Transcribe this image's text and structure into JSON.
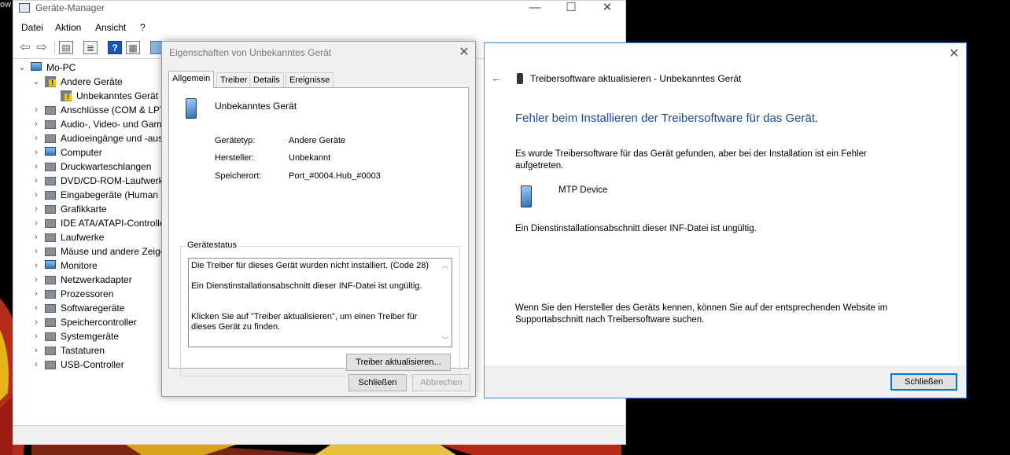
{
  "desktop": {
    "corner_text": "ow"
  },
  "device_manager": {
    "title": "Geräte-Manager",
    "window_controls": [
      "—",
      "☐",
      "✕"
    ],
    "menu": [
      "Datei",
      "Aktion",
      "Ansicht",
      "?"
    ],
    "tree": [
      {
        "label": "Mo-PC",
        "level": 0,
        "expander": "down",
        "icon": "computer-icon"
      },
      {
        "label": "Andere Geräte",
        "level": 1,
        "expander": "down",
        "icon": "warning-device-icon"
      },
      {
        "label": "Unbekanntes Gerät",
        "level": 2,
        "expander": "",
        "icon": "unknown-device-warning-icon"
      },
      {
        "label": "Anschlüsse (COM & LPT)",
        "level": 1,
        "expander": "right",
        "icon": "port-icon"
      },
      {
        "label": "Audio-, Video- und Gamecontroller",
        "level": 1,
        "expander": "right",
        "icon": "speaker-icon"
      },
      {
        "label": "Audioeingänge und -ausgänge",
        "level": 1,
        "expander": "right",
        "icon": "speaker-icon"
      },
      {
        "label": "Computer",
        "level": 1,
        "expander": "right",
        "icon": "monitor-icon"
      },
      {
        "label": "Druckwarteschlangen",
        "level": 1,
        "expander": "right",
        "icon": "printer-icon"
      },
      {
        "label": "DVD/CD-ROM-Laufwerke",
        "level": 1,
        "expander": "right",
        "icon": "disc-icon"
      },
      {
        "label": "Eingabegeräte (Human Interface Devices)",
        "level": 1,
        "expander": "right",
        "icon": "hid-icon"
      },
      {
        "label": "Grafikkarte",
        "level": 1,
        "expander": "right",
        "icon": "display-adapter-icon"
      },
      {
        "label": "IDE ATA/ATAPI-Controller",
        "level": 1,
        "expander": "right",
        "icon": "controller-icon"
      },
      {
        "label": "Laufwerke",
        "level": 1,
        "expander": "right",
        "icon": "drive-icon"
      },
      {
        "label": "Mäuse und andere Zeigegeräte",
        "level": 1,
        "expander": "right",
        "icon": "mouse-icon"
      },
      {
        "label": "Monitore",
        "level": 1,
        "expander": "right",
        "icon": "monitor-icon"
      },
      {
        "label": "Netzwerkadapter",
        "level": 1,
        "expander": "right",
        "icon": "network-icon"
      },
      {
        "label": "Prozessoren",
        "level": 1,
        "expander": "right",
        "icon": "processor-icon"
      },
      {
        "label": "Softwaregeräte",
        "level": 1,
        "expander": "right",
        "icon": "software-device-icon"
      },
      {
        "label": "Speichercontroller",
        "level": 1,
        "expander": "right",
        "icon": "storage-controller-icon"
      },
      {
        "label": "Systemgeräte",
        "level": 1,
        "expander": "right",
        "icon": "system-device-icon"
      },
      {
        "label": "Tastaturen",
        "level": 1,
        "expander": "right",
        "icon": "keyboard-icon"
      },
      {
        "label": "USB-Controller",
        "level": 1,
        "expander": "right",
        "icon": "usb-icon"
      }
    ]
  },
  "properties": {
    "title": "Eigenschaften von Unbekanntes Gerät",
    "close": "✕",
    "tabs": [
      {
        "label": "Allgemein",
        "active": true
      },
      {
        "label": "Treiber",
        "active": false
      },
      {
        "label": "Details",
        "active": false
      },
      {
        "label": "Ereignisse",
        "active": false
      }
    ],
    "device_name": "Unbekanntes Gerät",
    "fields": [
      {
        "label": "Gerätetyp:",
        "value": "Andere Geräte"
      },
      {
        "label": "Hersteller:",
        "value": "Unbekannt"
      },
      {
        "label": "Speicherort:",
        "value": "Port_#0004.Hub_#0003"
      }
    ],
    "status_group_label": "Gerätestatus",
    "status_lines": [
      "Die Treiber für dieses Gerät wurden nicht installiert. (Code 28)",
      "Ein Dienstinstallationsabschnitt dieser INF-Datei ist ungültig.",
      "Klicken Sie auf \"Treiber aktualisieren\", um einen Treiber für dieses Gerät zu finden."
    ],
    "update_driver_button": "Treiber aktualisieren...",
    "close_button": "Schließen",
    "cancel_button": "Abbrechen"
  },
  "driver_wizard": {
    "close": "✕",
    "back": "←",
    "title": "Treibersoftware aktualisieren - Unbekanntes Gerät",
    "heading": "Fehler beim Installieren der Treibersoftware für das Gerät.",
    "message": "Es wurde Treibersoftware für das Gerät gefunden, aber bei der Installation ist ein Fehler aufgetreten.",
    "device_name": "MTP Device",
    "error_detail": "Ein Dienstinstallationsabschnitt dieser INF-Datei ist ungültig.",
    "hint": "Wenn Sie den Hersteller des Geräts kennen, können Sie auf der entsprechenden Website im Supportabschnitt nach Treibersoftware suchen.",
    "close_button": "Schließen"
  },
  "colors": {
    "accent": "#0078d7",
    "heading_blue": "#1a4a94"
  }
}
